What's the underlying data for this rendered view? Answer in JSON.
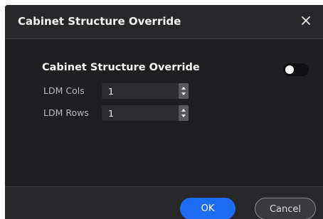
{
  "dialog": {
    "title": "Cabinet Structure Override",
    "close_icon": "close-icon"
  },
  "section": {
    "label": "Cabinet Structure Override",
    "toggle_on": false
  },
  "fields": [
    {
      "label": "LDM Cols",
      "value": "1"
    },
    {
      "label": "LDM Rows",
      "value": "1"
    }
  ],
  "footer": {
    "ok_label": "OK",
    "cancel_label": "Cancel"
  },
  "colors": {
    "accent": "#1e6cf2",
    "dialog_bg": "#1f1f21",
    "header_bg": "#28282b"
  }
}
